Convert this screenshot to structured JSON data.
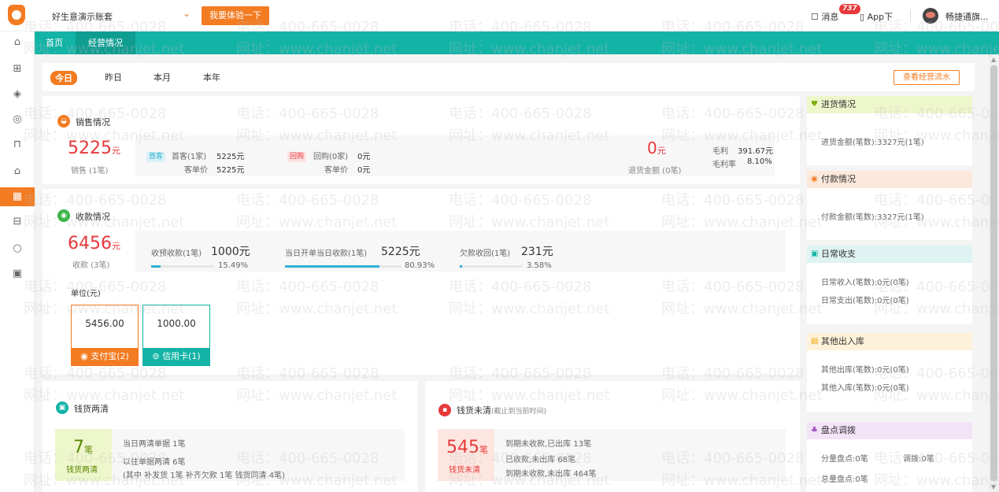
{
  "topbar": {
    "account": "好生意演示账套",
    "try_button": "我要体验一下",
    "messages_label": "消息",
    "messages_badge": "737",
    "app_download": "App下",
    "username": "畅捷通旗..."
  },
  "tabs": [
    {
      "label": "首页"
    },
    {
      "label": "经营情况"
    }
  ],
  "periods": [
    "今日",
    "昨日",
    "本月",
    "本年"
  ],
  "flow_button": "查看经营流水",
  "sales": {
    "title": "销售情况",
    "amount": "5225",
    "unit": "元",
    "count_label": "销售 (1笔)",
    "first_tag": "首客",
    "first_label": "首客(1家)",
    "first_value": "5225元",
    "first_avg_label": "客单价",
    "first_avg_value": "5225元",
    "repeat_tag": "回购",
    "repeat_label": "回购(0家)",
    "repeat_value": "0元",
    "repeat_avg_label": "客单价",
    "repeat_avg_value": "0元",
    "return_amount": "0",
    "return_unit": "元",
    "return_label": "退货金额 (0笔)",
    "gross_label": "毛利",
    "gross_value": "391.67元",
    "gross_rate_label": "毛利率",
    "gross_rate_value": "8.10%"
  },
  "receipts": {
    "title": "收款情况",
    "amount": "6456",
    "unit": "元",
    "count_label": "收款 (3笔)",
    "items": [
      {
        "label": "收预收款(1笔)",
        "value": "1000元",
        "pct": "15.49%",
        "fill": 0.155
      },
      {
        "label": "当日开单当日收款(1笔)",
        "value": "5225元",
        "pct": "80.93%",
        "fill": 0.809
      },
      {
        "label": "欠款收回(1笔)",
        "value": "231元",
        "pct": "3.58%",
        "fill": 0.036
      }
    ],
    "unit_label": "单位(元)",
    "methods": [
      {
        "amount": "5456.00",
        "label": "支付宝(2)",
        "color": "#f37b21"
      },
      {
        "amount": "1000.00",
        "label": "信用卡(1)",
        "color": "#13b3a6"
      }
    ]
  },
  "clear": {
    "title": "钱货两清",
    "count": "7",
    "count_unit": "笔",
    "badge": "钱货两清",
    "line1": "当日两清单据 1笔",
    "line2": "以往单据两清 6笔",
    "line3": "(其中 补发货 1笔  补齐欠款 1笔  钱货同清 4笔)"
  },
  "unclear": {
    "title": "钱货未清",
    "title_note": "(截止到当前时间)",
    "count": "545",
    "count_unit": "笔",
    "badge": "钱货未清",
    "line1": "到期未收款,已出库 13笔",
    "line2": "已收款,未出库 68笔",
    "line3": "到期未收款,未出库 464笔"
  },
  "right": {
    "purchase_title": "进货情况",
    "purchase_line": "进货金额(笔数):3327元(1笔)",
    "payment_title": "付款情况",
    "payment_line": "付款金额(笔数):3327元(1笔)",
    "daily_title": "日常收支",
    "daily_in": "日常收入(笔数):0元(0笔)",
    "daily_out": "日常支出(笔数):0元(0笔)",
    "other_title": "其他出入库",
    "other_out": "其他出库(笔数):0元(0笔)",
    "other_in": "其他入库(笔数):0元(0笔)",
    "stock_title": "盘点调拨",
    "stock_partial": "分量盘点:0笔",
    "stock_transfer": "调拨:0笔",
    "stock_total": "总量盘点:0笔"
  },
  "watermark": {
    "phone": "电话：400-665-0028",
    "site": "网址：www.chanjet.net"
  },
  "colors": {
    "accent": "#f37b21",
    "teal": "#13b3a6",
    "red": "#e5393b"
  }
}
